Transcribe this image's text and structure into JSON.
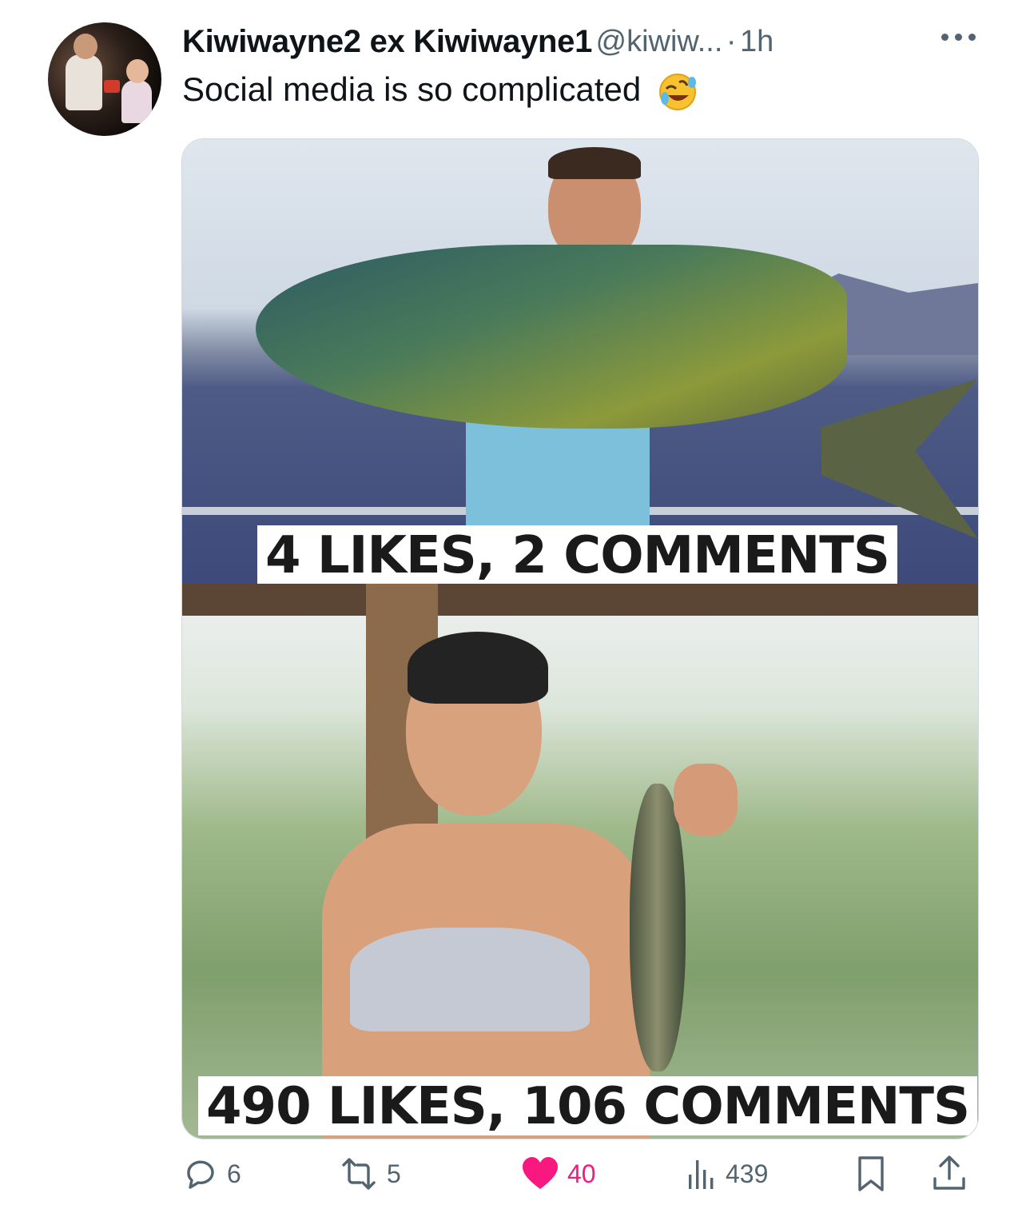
{
  "post": {
    "display_name": "Kiwiwayne2 ex Kiwiwayne1",
    "handle": "@kiwiw...",
    "separator": "·",
    "time": "1h",
    "text": "Social media is so complicated",
    "emoji": "rolling-on-floor-laughing"
  },
  "image": {
    "caption_top": "4 LIKES, 2 COMMENTS",
    "caption_bottom": "490 LIKES, 106 COMMENTS"
  },
  "actions": {
    "replies": "6",
    "reposts": "5",
    "likes": "40",
    "views": "439"
  },
  "colors": {
    "muted": "#536471",
    "like": "#f91880",
    "text": "#0f1419"
  },
  "icons": [
    "more-icon",
    "reply-icon",
    "repost-icon",
    "like-icon",
    "views-icon",
    "bookmark-icon",
    "share-icon"
  ]
}
